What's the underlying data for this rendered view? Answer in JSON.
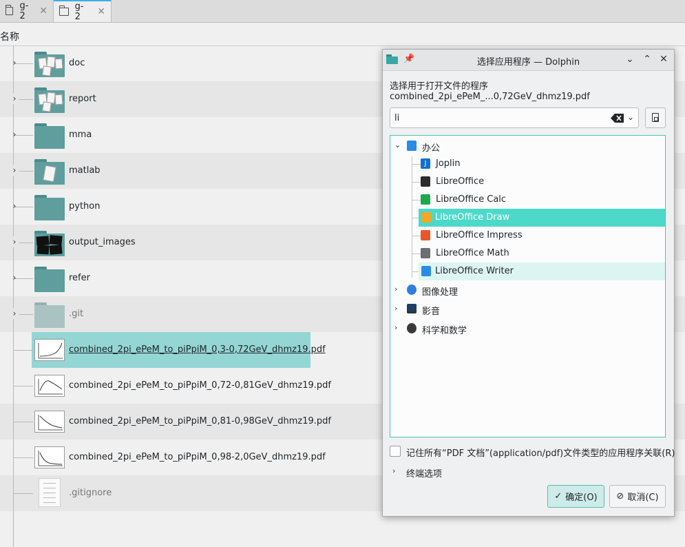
{
  "tabs": [
    {
      "label": "g-2"
    },
    {
      "label": "g-2"
    }
  ],
  "column_header": "名称",
  "files": [
    {
      "name": "doc",
      "type": "folder-docs"
    },
    {
      "name": "report",
      "type": "folder-docs"
    },
    {
      "name": "mma",
      "type": "folder"
    },
    {
      "name": "matlab",
      "type": "folder-doc"
    },
    {
      "name": "python",
      "type": "folder"
    },
    {
      "name": "output_images",
      "type": "folder-images"
    },
    {
      "name": "refer",
      "type": "folder"
    },
    {
      "name": ".git",
      "type": "folder-hidden"
    },
    {
      "name": "combined_2pi_ePeM_to_piPpiM_0,3-0,72GeV_dhmz19.pdf",
      "type": "pdf",
      "selected": true
    },
    {
      "name": "combined_2pi_ePeM_to_piPpiM_0,72-0,81GeV_dhmz19.pdf",
      "type": "pdf"
    },
    {
      "name": "combined_2pi_ePeM_to_piPpiM_0,81-0,98GeV_dhmz19.pdf",
      "type": "pdf"
    },
    {
      "name": "combined_2pi_ePeM_to_piPpiM_0,98-2,0GeV_dhmz19.pdf",
      "type": "pdf"
    },
    {
      "name": ".gitignore",
      "type": "text"
    }
  ],
  "dialog": {
    "title": "选择应用程序 — Dolphin",
    "prompt": "选择用于打开文件的程序",
    "filename": "combined_2pi_ePeM_...0,72GeV_dhmz19.pdf",
    "search_value": "li",
    "categories": [
      {
        "label": "办公",
        "expanded": true,
        "icon": "office-icon",
        "apps": [
          {
            "label": "Joplin",
            "icon": "joplin-icon",
            "color": "#1071d3"
          },
          {
            "label": "LibreOffice",
            "icon": "libreoffice-icon",
            "color": "#2b2b2b"
          },
          {
            "label": "LibreOffice Calc",
            "icon": "calc-icon",
            "color": "#1ea84f"
          },
          {
            "label": "LibreOffice Draw",
            "icon": "draw-icon",
            "color": "#f5a623",
            "selected": true
          },
          {
            "label": "LibreOffice Impress",
            "icon": "impress-icon",
            "color": "#e8572a"
          },
          {
            "label": "LibreOffice Math",
            "icon": "math-icon",
            "color": "#6b6e73"
          },
          {
            "label": "LibreOffice Writer",
            "icon": "writer-icon",
            "color": "#2a8ce4",
            "hovered": true
          }
        ]
      },
      {
        "label": "图像处理",
        "expanded": false,
        "icon": "graphics-icon"
      },
      {
        "label": "影音",
        "expanded": false,
        "icon": "multimedia-icon"
      },
      {
        "label": "科学和数学",
        "expanded": false,
        "icon": "science-icon"
      }
    ],
    "remember_label": "记住所有“PDF 文档”(application/pdf)文件类型的应用程序关联(R)",
    "remember_checked": false,
    "terminal_label": "终端选项",
    "ok_label": "确定(O)",
    "cancel_label": "取消(C)"
  },
  "colors": {
    "accent": "#3daee9",
    "selection": "#4dd9c9",
    "folder": "#5f9e9d"
  }
}
